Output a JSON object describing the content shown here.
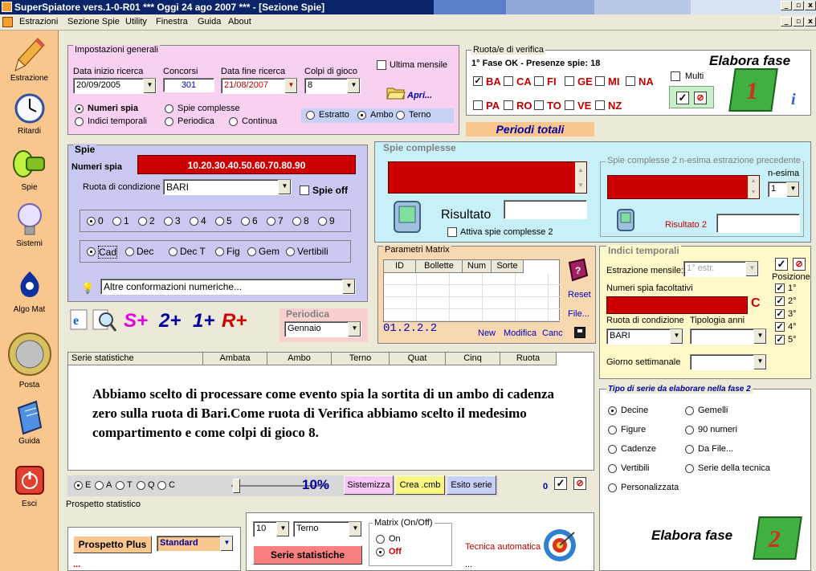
{
  "window": {
    "title": "SuperSpiatore vers.1-0-R01  ***  Oggi 24 ago 2007  ***  - [Sezione Spie]",
    "controls": [
      "_",
      "▫",
      "x"
    ]
  },
  "menu": [
    "Estrazioni",
    "Sezione Spie",
    "Utility",
    "Finestra",
    "Guida",
    "About"
  ],
  "sidebar": [
    {
      "label": "Estrazione",
      "icon": "pencil-icon"
    },
    {
      "label": "Ritardi",
      "icon": "clock-icon"
    },
    {
      "label": "Spie",
      "icon": "flashlight-icon"
    },
    {
      "label": "Sistemi",
      "icon": "lightbulb-icon"
    },
    {
      "label": "Algo Mat",
      "icon": "lottery-icon"
    },
    {
      "label": "Posta",
      "icon": "coin-icon"
    },
    {
      "label": "Guida",
      "icon": "book-icon"
    },
    {
      "label": "Esci",
      "icon": "exit-icon"
    }
  ],
  "general": {
    "title": "Impostazioni generali",
    "start_label": "Data inizio ricerca",
    "start_value": "20/09/2005",
    "draws_label": "Concorsi",
    "draws_value": "301",
    "end_label": "Data fine ricerca",
    "end_value": "21/08/2007",
    "shots_label": "Colpi di gioco",
    "shots_value": "8",
    "last_month": "Ultima mensile",
    "open": "Apri...",
    "mode_numbers": "Numeri spia",
    "mode_complex": "Spie complesse",
    "mode_time": "Indici temporali",
    "mode_periodic": "Periodica",
    "mode_continuous": "Continua",
    "bet_extract": "Estratto",
    "bet_ambo": "Ambo",
    "bet_terno": "Terno"
  },
  "verify": {
    "title": "Ruota/e di verifica",
    "phase": "1° Fase OK - Presenze spie: 18",
    "wheels_row1": [
      {
        "name": "BA",
        "checked": true
      },
      {
        "name": "CA",
        "checked": false
      },
      {
        "name": "FI",
        "checked": false
      },
      {
        "name": "GE",
        "checked": false
      },
      {
        "name": "MI",
        "checked": false
      },
      {
        "name": "NA",
        "checked": false
      }
    ],
    "wheels_row2": [
      {
        "name": "PA",
        "checked": false
      },
      {
        "name": "RO",
        "checked": false
      },
      {
        "name": "TO",
        "checked": false
      },
      {
        "name": "VE",
        "checked": false
      },
      {
        "name": "NZ",
        "checked": false
      }
    ],
    "multi": "Multi",
    "elabora": "Elabora fase",
    "phase_number": "1"
  },
  "periods": "Periodi totali",
  "spie": {
    "title": "Spie",
    "numbers_label": "Numeri spia",
    "numbers_value": "10.20.30.40.50.60.70.80.90",
    "wheel_label": "Ruota di condizione",
    "wheel_value": "BARI",
    "off_label": "Spie off",
    "digits": [
      "0",
      "1",
      "2",
      "3",
      "4",
      "5",
      "6",
      "7",
      "8",
      "9"
    ],
    "types": [
      "Cad",
      "Dec",
      "Dec T",
      "Fig",
      "Gem",
      "Vertibili"
    ],
    "other_label": "Altre conformazioni numeriche..."
  },
  "toolbar_symbols": [
    "S+",
    "2+",
    "1+",
    "R+"
  ],
  "periodica": {
    "title": "Periodica",
    "value": "Gennaio"
  },
  "complex": {
    "title": "Spie complesse",
    "result_label": "Risultato",
    "activate_label": "Attiva spie complesse 2",
    "nth_title": "Spie complesse 2 n-esima estrazione precedente",
    "nth_label": "n-esima",
    "nth_value": "1",
    "result2_label": "Risultato 2"
  },
  "matrix": {
    "title": "Parametri Matrix",
    "columns": [
      "ID",
      "Bollette",
      "Num",
      "Sorte"
    ],
    "reset": "Reset",
    "file": "File...",
    "code": "01.2.2.2",
    "new": "New",
    "modify": "Modifica",
    "cancel": "Canc"
  },
  "time": {
    "title": "Indici temporali",
    "monthly_label": "Estrazione mensile:",
    "monthly_value": "1° estr.",
    "position_label": "Posizione",
    "positions": [
      "1°",
      "2°",
      "3°",
      "4°",
      "5°"
    ],
    "optional_label": "Numeri spia facoltativi",
    "c_label": "C",
    "wheel_label": "Ruota di condizione",
    "wheel_value": "BARI",
    "years_label": "Tipologia anni",
    "weekday_label": "Giorno settimanale"
  },
  "stats": {
    "columns": [
      "Serie statistiche",
      "Ambata",
      "Ambo",
      "Terno",
      "Quat",
      "Cinq",
      "Ruota"
    ],
    "note": "Abbiamo scelto di processare come evento spia la sortita di un ambo di cadenza zero sulla ruota di Bari.Come ruota di Verifica abbiamo scelto il medesimo compartimento e come colpi di gioco 8."
  },
  "bottom": {
    "radios": [
      "E",
      "A",
      "T",
      "Q",
      "C"
    ],
    "percent": "10%",
    "sistemizza": "Sistemizza",
    "crea": "Crea .cmb",
    "esito": "Esito serie",
    "zero": "0",
    "prospetto_label": "Prospetto statistico",
    "prospetto_plus": "Prospetto Plus",
    "standard": "Standard",
    "dots": "...",
    "count_value": "10",
    "sort_value": "Terno",
    "serie_btn": "Serie statistiche",
    "matrix_title": "Matrix (On/Off)",
    "on": "On",
    "off": "Off",
    "tecnica": "Tecnica automatica",
    "tecnica_dots": "..."
  },
  "series_type": {
    "title": "Tipo di serie da elaborare nella fase 2",
    "options_left": [
      "Decine",
      "Figure",
      "Cadenze",
      "Vertibili",
      "Personalizzata"
    ],
    "options_right": [
      "Gemelli",
      "90 numeri",
      "Da File...",
      "Serie della tecnica"
    ],
    "elabora": "Elabora fase",
    "phase_number": "2"
  },
  "colors": {
    "red_field": "#cc0000",
    "pink_panel": "#f8d0f0",
    "blue_panel": "#c8c8f0",
    "cyan_panel": "#c8f0f8",
    "yellow_panel": "#fff8c8",
    "orange_panel": "#f9c68e"
  }
}
